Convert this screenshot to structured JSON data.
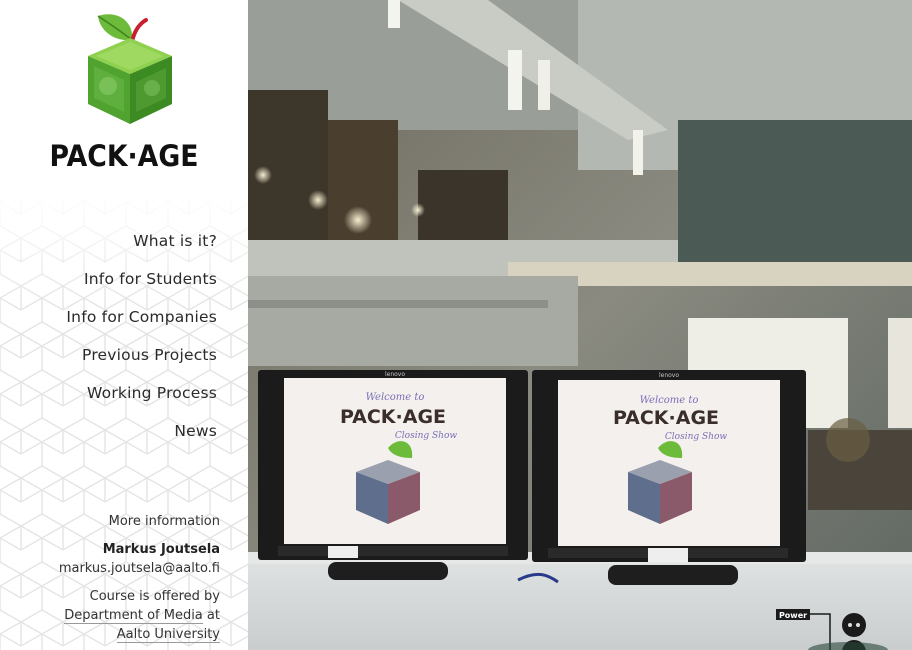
{
  "brand": {
    "logo_text": "PACK·AGE"
  },
  "nav": {
    "items": [
      {
        "label": "What is it?"
      },
      {
        "label": "Info for Students"
      },
      {
        "label": "Info for Companies"
      },
      {
        "label": "Previous Projects"
      },
      {
        "label": "Working Process"
      },
      {
        "label": "News"
      }
    ]
  },
  "info": {
    "heading": "More information",
    "contact_name": "Markus Joutsela",
    "contact_email": "markus.joutsela@aalto.fi",
    "course_text": "Course is offered by",
    "department_link": "Department of Media",
    "at_text": "at",
    "university_link": "Aalto University"
  },
  "photo": {
    "screen_title": "Welcome to",
    "screen_logo": "PACK·AGE",
    "screen_subtitle": "Closing Show",
    "monitor_brand": "lenovo",
    "power_label": "Power"
  },
  "colors": {
    "leaf_green": "#5aa82e",
    "cube_green": "#4c9a2a",
    "apple_red": "#c8202f",
    "text": "#2a2a2a"
  }
}
